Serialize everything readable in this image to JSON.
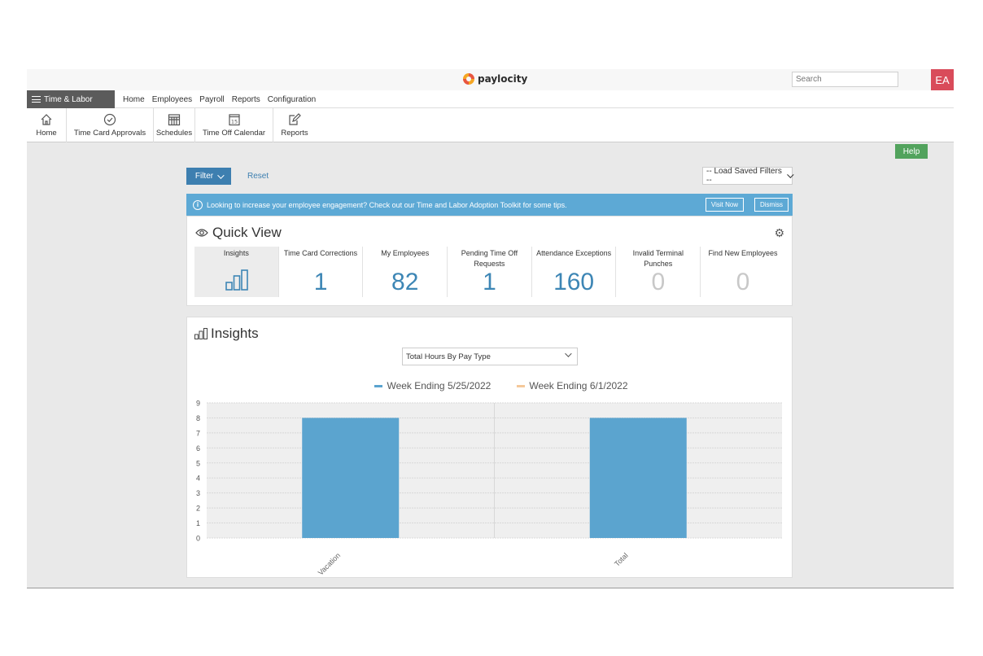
{
  "topbar": {
    "logo_text": "paylocity",
    "search_placeholder": "Search",
    "avatar_initials": "EA"
  },
  "nav": {
    "module": "Time & Labor",
    "links": [
      "Home",
      "Employees",
      "Payroll",
      "Reports",
      "Configuration"
    ]
  },
  "toolbar": [
    {
      "label": "Home",
      "icon": "home-icon"
    },
    {
      "label": "Time Card Approvals",
      "icon": "check-circle-icon"
    },
    {
      "label": "Schedules",
      "icon": "schedule-grid-icon"
    },
    {
      "label": "Time Off Calendar",
      "icon": "calendar-15-icon",
      "calendar_day": "15"
    },
    {
      "label": "Reports",
      "icon": "edit-report-icon"
    }
  ],
  "help_label": "Help",
  "filter": {
    "button_label": "Filter",
    "reset_label": "Reset",
    "saved_filters": "-- Load Saved Filters --"
  },
  "banner": {
    "text": "Looking to increase your employee engagement? Check out our Time and Labor Adoption Toolkit for some tips.",
    "visit_label": "Visit Now",
    "dismiss_label": "Dismiss"
  },
  "quick_view": {
    "title": "Quick View",
    "tiles": [
      {
        "label": "Insights",
        "icon": "bar-chart-icon"
      },
      {
        "label": "Time Card Corrections",
        "value": "1"
      },
      {
        "label": "My Employees",
        "value": "82"
      },
      {
        "label": "Pending Time Off Requests",
        "value": "1"
      },
      {
        "label": "Attendance Exceptions",
        "value": "160"
      },
      {
        "label": "Invalid Terminal Punches",
        "value": "0"
      },
      {
        "label": "Find New Employees",
        "value": "0"
      }
    ]
  },
  "insights": {
    "title": "Insights",
    "selected": "Total Hours By Pay Type"
  },
  "chart_data": {
    "type": "bar",
    "categories": [
      "Vacation",
      "Total"
    ],
    "series": [
      {
        "name": "Week Ending 5/25/2022",
        "values": [
          8,
          8
        ],
        "color": "#5ba4cf"
      },
      {
        "name": "Week Ending 6/1/2022",
        "values": [
          0,
          0
        ],
        "color": "#f5c89a"
      }
    ],
    "ylim": [
      0,
      9
    ],
    "yticks": [
      "0",
      "1",
      "2",
      "3",
      "4",
      "5",
      "6",
      "7",
      "8",
      "9"
    ],
    "legend": "top-center",
    "grid": true
  }
}
